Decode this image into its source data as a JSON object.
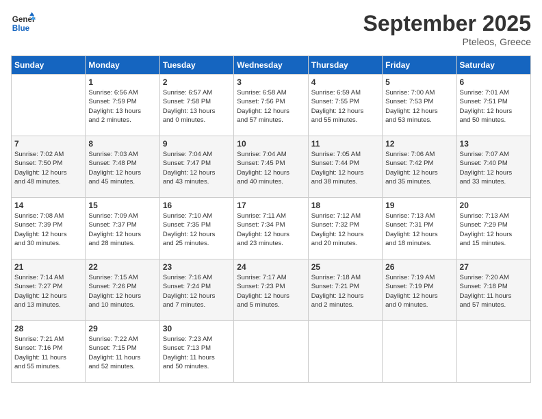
{
  "header": {
    "logo_line1": "General",
    "logo_line2": "Blue",
    "month": "September 2025",
    "location": "Pteleos, Greece"
  },
  "weekdays": [
    "Sunday",
    "Monday",
    "Tuesday",
    "Wednesday",
    "Thursday",
    "Friday",
    "Saturday"
  ],
  "weeks": [
    [
      {
        "day": "",
        "info": ""
      },
      {
        "day": "1",
        "info": "Sunrise: 6:56 AM\nSunset: 7:59 PM\nDaylight: 13 hours\nand 2 minutes."
      },
      {
        "day": "2",
        "info": "Sunrise: 6:57 AM\nSunset: 7:58 PM\nDaylight: 13 hours\nand 0 minutes."
      },
      {
        "day": "3",
        "info": "Sunrise: 6:58 AM\nSunset: 7:56 PM\nDaylight: 12 hours\nand 57 minutes."
      },
      {
        "day": "4",
        "info": "Sunrise: 6:59 AM\nSunset: 7:55 PM\nDaylight: 12 hours\nand 55 minutes."
      },
      {
        "day": "5",
        "info": "Sunrise: 7:00 AM\nSunset: 7:53 PM\nDaylight: 12 hours\nand 53 minutes."
      },
      {
        "day": "6",
        "info": "Sunrise: 7:01 AM\nSunset: 7:51 PM\nDaylight: 12 hours\nand 50 minutes."
      }
    ],
    [
      {
        "day": "7",
        "info": "Sunrise: 7:02 AM\nSunset: 7:50 PM\nDaylight: 12 hours\nand 48 minutes."
      },
      {
        "day": "8",
        "info": "Sunrise: 7:03 AM\nSunset: 7:48 PM\nDaylight: 12 hours\nand 45 minutes."
      },
      {
        "day": "9",
        "info": "Sunrise: 7:04 AM\nSunset: 7:47 PM\nDaylight: 12 hours\nand 43 minutes."
      },
      {
        "day": "10",
        "info": "Sunrise: 7:04 AM\nSunset: 7:45 PM\nDaylight: 12 hours\nand 40 minutes."
      },
      {
        "day": "11",
        "info": "Sunrise: 7:05 AM\nSunset: 7:44 PM\nDaylight: 12 hours\nand 38 minutes."
      },
      {
        "day": "12",
        "info": "Sunrise: 7:06 AM\nSunset: 7:42 PM\nDaylight: 12 hours\nand 35 minutes."
      },
      {
        "day": "13",
        "info": "Sunrise: 7:07 AM\nSunset: 7:40 PM\nDaylight: 12 hours\nand 33 minutes."
      }
    ],
    [
      {
        "day": "14",
        "info": "Sunrise: 7:08 AM\nSunset: 7:39 PM\nDaylight: 12 hours\nand 30 minutes."
      },
      {
        "day": "15",
        "info": "Sunrise: 7:09 AM\nSunset: 7:37 PM\nDaylight: 12 hours\nand 28 minutes."
      },
      {
        "day": "16",
        "info": "Sunrise: 7:10 AM\nSunset: 7:35 PM\nDaylight: 12 hours\nand 25 minutes."
      },
      {
        "day": "17",
        "info": "Sunrise: 7:11 AM\nSunset: 7:34 PM\nDaylight: 12 hours\nand 23 minutes."
      },
      {
        "day": "18",
        "info": "Sunrise: 7:12 AM\nSunset: 7:32 PM\nDaylight: 12 hours\nand 20 minutes."
      },
      {
        "day": "19",
        "info": "Sunrise: 7:13 AM\nSunset: 7:31 PM\nDaylight: 12 hours\nand 18 minutes."
      },
      {
        "day": "20",
        "info": "Sunrise: 7:13 AM\nSunset: 7:29 PM\nDaylight: 12 hours\nand 15 minutes."
      }
    ],
    [
      {
        "day": "21",
        "info": "Sunrise: 7:14 AM\nSunset: 7:27 PM\nDaylight: 12 hours\nand 13 minutes."
      },
      {
        "day": "22",
        "info": "Sunrise: 7:15 AM\nSunset: 7:26 PM\nDaylight: 12 hours\nand 10 minutes."
      },
      {
        "day": "23",
        "info": "Sunrise: 7:16 AM\nSunset: 7:24 PM\nDaylight: 12 hours\nand 7 minutes."
      },
      {
        "day": "24",
        "info": "Sunrise: 7:17 AM\nSunset: 7:23 PM\nDaylight: 12 hours\nand 5 minutes."
      },
      {
        "day": "25",
        "info": "Sunrise: 7:18 AM\nSunset: 7:21 PM\nDaylight: 12 hours\nand 2 minutes."
      },
      {
        "day": "26",
        "info": "Sunrise: 7:19 AM\nSunset: 7:19 PM\nDaylight: 12 hours\nand 0 minutes."
      },
      {
        "day": "27",
        "info": "Sunrise: 7:20 AM\nSunset: 7:18 PM\nDaylight: 11 hours\nand 57 minutes."
      }
    ],
    [
      {
        "day": "28",
        "info": "Sunrise: 7:21 AM\nSunset: 7:16 PM\nDaylight: 11 hours\nand 55 minutes."
      },
      {
        "day": "29",
        "info": "Sunrise: 7:22 AM\nSunset: 7:15 PM\nDaylight: 11 hours\nand 52 minutes."
      },
      {
        "day": "30",
        "info": "Sunrise: 7:23 AM\nSunset: 7:13 PM\nDaylight: 11 hours\nand 50 minutes."
      },
      {
        "day": "",
        "info": ""
      },
      {
        "day": "",
        "info": ""
      },
      {
        "day": "",
        "info": ""
      },
      {
        "day": "",
        "info": ""
      }
    ]
  ]
}
